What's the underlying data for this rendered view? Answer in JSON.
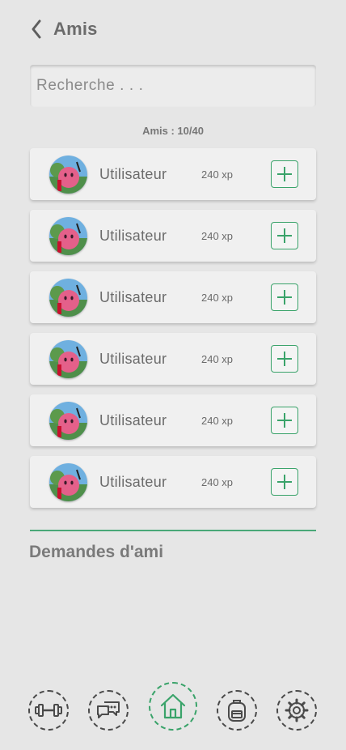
{
  "header": {
    "title": "Amis"
  },
  "search": {
    "placeholder": "Recherche . . ."
  },
  "friends": {
    "count_label": "Amis : 10/40",
    "items": [
      {
        "name": "Utilisateur",
        "xp": "240 xp"
      },
      {
        "name": "Utilisateur",
        "xp": "240 xp"
      },
      {
        "name": "Utilisateur",
        "xp": "240 xp"
      },
      {
        "name": "Utilisateur",
        "xp": "240 xp"
      },
      {
        "name": "Utilisateur",
        "xp": "240 xp"
      },
      {
        "name": "Utilisateur",
        "xp": "240 xp"
      }
    ]
  },
  "requests": {
    "title": "Demandes d'ami"
  },
  "nav": {
    "items": [
      {
        "icon": "dumbbell-icon"
      },
      {
        "icon": "chat-icon"
      },
      {
        "icon": "home-icon",
        "active": true
      },
      {
        "icon": "backpack-icon"
      },
      {
        "icon": "gear-icon"
      }
    ]
  },
  "colors": {
    "accent": "#3aa36a",
    "background": "#e6e6e6",
    "card": "#f0f0f0",
    "text": "#6b6b6b"
  }
}
